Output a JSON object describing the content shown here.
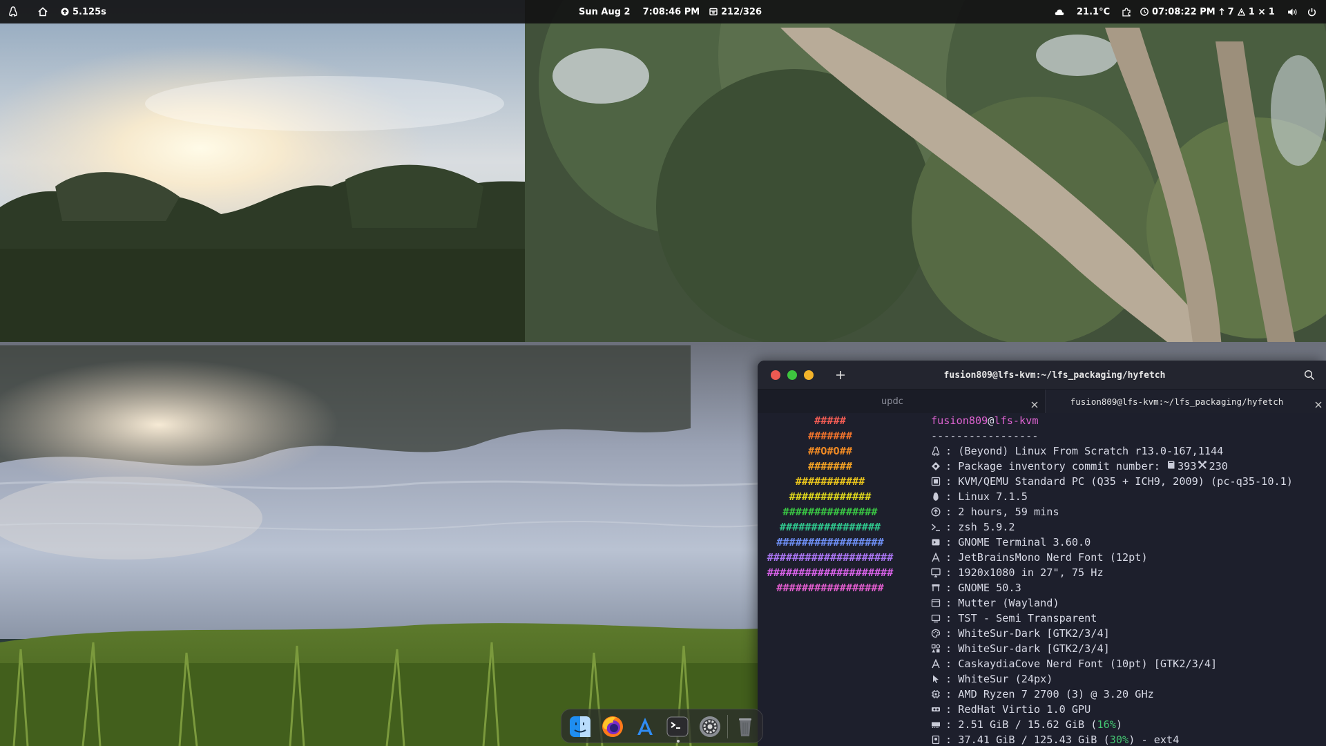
{
  "topbar": {
    "left": {
      "distro_icon": "linux-tux-icon",
      "home_icon": "home-icon",
      "timer_icon": "arrow-up-circle-icon",
      "timer": "5.125s"
    },
    "center": {
      "date": "Sun Aug 2",
      "time": "7:08:46 PM",
      "packages_icon": "package-box-icon",
      "packages": "212/326"
    },
    "right": {
      "weather_icon": "cloud-icon",
      "temperature": "21.1°C",
      "extension_icon": "puzzle-icon",
      "clock_icon": "clock-icon",
      "clock": "07:08:22 PM",
      "updates_icon": "arrow-up-icon",
      "updates": "7",
      "warnings_icon": "warning-triangle-icon",
      "warnings": "1",
      "errors_icon": "x-icon",
      "errors": "1",
      "volume_icon": "speaker-icon",
      "power_icon": "power-icon"
    }
  },
  "terminal": {
    "title": "fusion809@lfs-kvm:~/lfs_packaging/hyfetch",
    "tabs": [
      {
        "label": "updc",
        "active": false
      },
      {
        "label": "fusion809@lfs-kvm:~/lfs_packaging/hyfetch",
        "active": true
      }
    ],
    "ascii_art": [
      {
        "text": "#####",
        "color": "#f25c54"
      },
      {
        "text": "#######",
        "color": "#f0732c"
      },
      {
        "text": "##O#O##",
        "color": "#f08a24"
      },
      {
        "text": "#######",
        "color": "#f0a024"
      },
      {
        "text": "###########",
        "color": "#e7c21c"
      },
      {
        "text": "#############",
        "color": "#dcd41c"
      },
      {
        "text": "###############",
        "color": "#39c443"
      },
      {
        "text": "################",
        "color": "#2fc48c"
      },
      {
        "text": "#################",
        "color": "#6c8cf0"
      },
      {
        "text": "####################",
        "color": "#a874f0"
      },
      {
        "text": "####################",
        "color": "#d661e6"
      },
      {
        "text": "#################",
        "color": "#e05ccd"
      }
    ],
    "header_user": "fusion809",
    "header_at": "@",
    "header_host": "lfs-kvm",
    "separator": "-----------------",
    "info": [
      {
        "icon": "linux-tux-icon",
        "text": ": (Beyond) Linux From Scratch r13.0-167,1144"
      },
      {
        "icon": "package-icon",
        "text": ": Package inventory commit number: ",
        "extra": [
          {
            "icon": "book-icon",
            "text": "393"
          },
          {
            "icon": "tools-icon",
            "text": "230"
          }
        ]
      },
      {
        "icon": "motherboard-icon",
        "text": ": KVM/QEMU Standard PC (Q35 + ICH9, 2009) (pc-q35-10.1)"
      },
      {
        "icon": "penguin-icon",
        "text": ": Linux 7.1.5"
      },
      {
        "icon": "uptime-icon",
        "text": ": 2 hours, 59 mins"
      },
      {
        "icon": "shell-prompt-icon",
        "text": ": zsh 5.9.2"
      },
      {
        "icon": "terminal-icon",
        "text": ": GNOME Terminal 3.60.0"
      },
      {
        "icon": "font-icon",
        "text": ": JetBrainsMono Nerd Font (12pt)"
      },
      {
        "icon": "monitor-icon",
        "text": ": 1920x1080 in 27\", 75 Hz"
      },
      {
        "icon": "desktop-environment-icon",
        "text": ": GNOME 50.3"
      },
      {
        "icon": "window-manager-icon",
        "text": ": Mutter (Wayland)"
      },
      {
        "icon": "wm-theme-icon",
        "text": ": TST - Semi Transparent"
      },
      {
        "icon": "theme-palette-icon",
        "text": ": WhiteSur-Dark [GTK2/3/4]"
      },
      {
        "icon": "icons-grid-icon",
        "text": ": WhiteSur-dark [GTK2/3/4]"
      },
      {
        "icon": "font-icon",
        "text": ": CaskaydiaCove Nerd Font (10pt) [GTK2/3/4]"
      },
      {
        "icon": "cursor-icon",
        "text": ": WhiteSur (24px)"
      },
      {
        "icon": "cpu-icon",
        "text": ": AMD Ryzen 7 2700 (3) @ 3.20 GHz"
      },
      {
        "icon": "gpu-icon",
        "text": ": RedHat Virtio 1.0 GPU"
      },
      {
        "icon": "memory-icon",
        "text": ": 2.51 GiB / 15.62 GiB (",
        "highlight": "16%",
        "tail": ")"
      },
      {
        "icon": "disk-icon",
        "text": ": 37.41 GiB / 125.43 GiB (",
        "highlight": "30%",
        "tail": ") - ext4"
      }
    ]
  },
  "dock": {
    "items": [
      {
        "name": "finder-icon"
      },
      {
        "name": "firefox-icon"
      },
      {
        "name": "app-launcher-icon"
      },
      {
        "name": "terminal-icon",
        "running": true
      },
      {
        "name": "system-settings-icon"
      },
      {
        "name": "trash-icon"
      }
    ]
  },
  "colors": {
    "terminal_bg": "#1d1f2c",
    "pink": "#e064d3",
    "green": "#44c572",
    "close": "#ee5a52",
    "minimize": "#3ec43f",
    "maximize": "#f3b32a"
  }
}
